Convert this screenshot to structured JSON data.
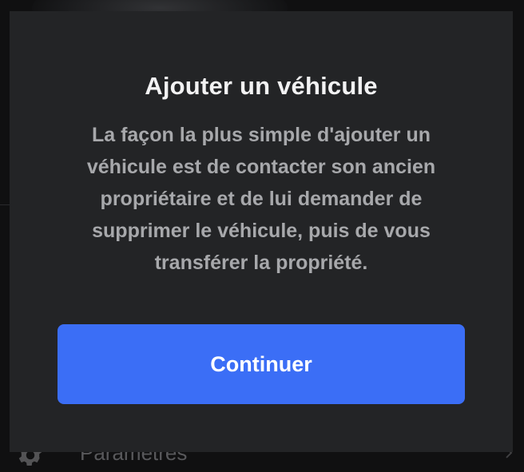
{
  "background": {
    "settings_label": "Paramètres",
    "settings_icon": "gear-icon",
    "chevron_icon": "chevron-right-icon"
  },
  "modal": {
    "title": "Ajouter un véhicule",
    "body": "La façon la plus simple d'ajouter un véhicule est de contacter son ancien propriétaire et de lui demander de supprimer le véhicule, puis de vous transférer la propriété.",
    "continue_label": "Continuer"
  },
  "colors": {
    "modal_background": "#232426",
    "primary_button": "#3b6ef6",
    "title_text": "#f2f2f3",
    "body_text": "#a7a8ab"
  }
}
